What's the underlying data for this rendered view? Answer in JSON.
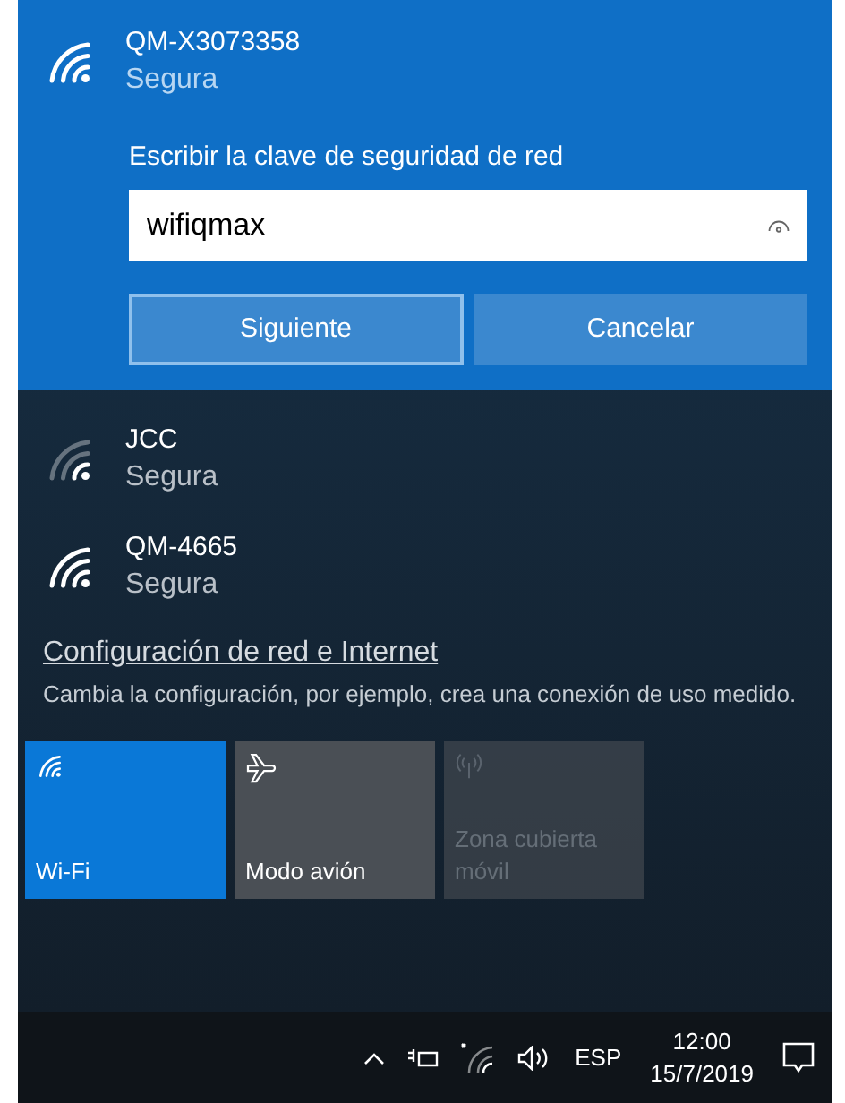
{
  "networks": [
    {
      "name": "QM-X3073358",
      "status": "Segura",
      "selected": true,
      "password_label": "Escribir la clave de seguridad de red",
      "password_value": "wifiqmax",
      "buttons": [
        {
          "label": "Siguiente",
          "focused": true
        },
        {
          "label": "Cancelar",
          "focused": false
        }
      ]
    },
    {
      "name": "JCC",
      "status": "Segura",
      "selected": false
    },
    {
      "name": "QM-4665",
      "status": "Segura",
      "selected": false
    }
  ],
  "settings": {
    "link": "Configuración de red e Internet",
    "description": "Cambia la configuración, por ejemplo, crea una conexión de uso medido."
  },
  "tiles": [
    {
      "kind": "wifi",
      "label": "Wi-Fi",
      "on": true,
      "disabled": false
    },
    {
      "kind": "airplane",
      "label": "Modo avión",
      "on": false,
      "disabled": false
    },
    {
      "kind": "hotspot",
      "label": "Zona cubierta móvil",
      "on": false,
      "disabled": true
    }
  ],
  "taskbar": {
    "language": "ESP",
    "time": "12:00",
    "date": "15/7/2019"
  }
}
